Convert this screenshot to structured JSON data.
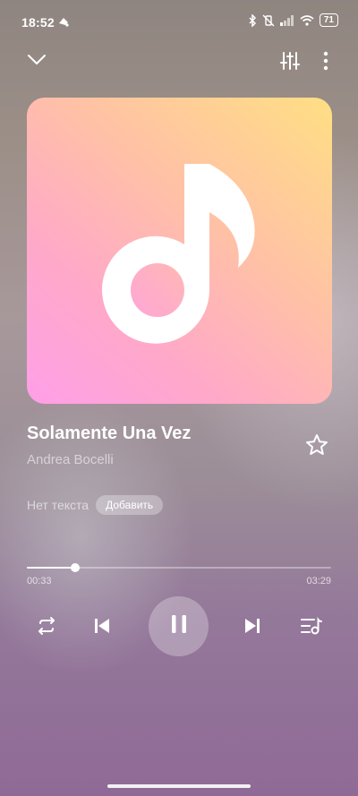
{
  "status_bar": {
    "time": "18:52",
    "battery": "71"
  },
  "track": {
    "title": "Solamente Una Vez",
    "artist": "Andrea Bocelli"
  },
  "lyrics": {
    "empty_label": "Нет текста",
    "add_button": "Добавить"
  },
  "progress": {
    "current": "00:33",
    "total": "03:29",
    "fraction": 0.16
  },
  "icons": {
    "collapse": "chevron-down-icon",
    "equalizer": "equalizer-icon",
    "more": "more-vertical-icon",
    "favorite": "star-outline-icon",
    "repeat": "repeat-icon",
    "previous": "skip-previous-icon",
    "pause": "pause-icon",
    "next": "skip-next-icon",
    "queue": "playlist-icon",
    "cover": "music-note-icon"
  }
}
